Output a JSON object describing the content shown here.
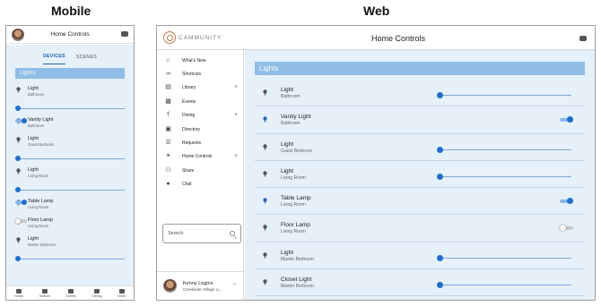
{
  "captions": {
    "mobile": "Mobile",
    "web": "Web"
  },
  "colors": {
    "accent": "#1f6fc8",
    "header_band": "#8fbde6",
    "content_bg": "#e6f0f9"
  },
  "mobile": {
    "header": {
      "title": "Home Controls",
      "chat_icon": "chat-bubble-icon"
    },
    "tabs": [
      {
        "label": "DEVICES",
        "active": true
      },
      {
        "label": "SCENES",
        "active": false
      }
    ],
    "section_title": "Lights",
    "lights": [
      {
        "name": "Light",
        "room": "Bathroom",
        "control": "slider",
        "level": 0
      },
      {
        "name": "Vanity Light",
        "room": "Bathroom",
        "control": "toggle",
        "on": true
      },
      {
        "name": "Light",
        "room": "Guest Bedroom",
        "control": "slider",
        "level": 0
      },
      {
        "name": "Light",
        "room": "Living Room",
        "control": "slider",
        "level": 0
      },
      {
        "name": "Table Lamp",
        "room": "Living Room",
        "control": "toggle",
        "on": true
      },
      {
        "name": "Floor Lamp",
        "room": "Living Room",
        "control": "toggle",
        "on": false
      },
      {
        "name": "Light",
        "room": "Master Bedroom",
        "control": "slider",
        "level": 0
      }
    ],
    "bottom_nav": [
      {
        "label": "Home",
        "icon": "home-icon"
      },
      {
        "label": "Search",
        "icon": "search-icon"
      },
      {
        "label": "Events",
        "icon": "calendar-icon"
      },
      {
        "label": "Dining",
        "icon": "dining-icon"
      },
      {
        "label": "More",
        "icon": "more-icon"
      }
    ]
  },
  "web": {
    "header": {
      "logo_text": "CAMMUNITY",
      "title": "Home Controls",
      "chat_icon": "chat-bubble-icon"
    },
    "sidebar": {
      "items": [
        {
          "label": "What's New",
          "icon": "home-icon",
          "expandable": false
        },
        {
          "label": "Shortcuts",
          "icon": "link-icon",
          "expandable": false
        },
        {
          "label": "Library",
          "icon": "book-icon",
          "expandable": true
        },
        {
          "label": "Events",
          "icon": "calendar-icon",
          "expandable": false
        },
        {
          "label": "Dining",
          "icon": "dining-icon",
          "expandable": true
        },
        {
          "label": "Directory",
          "icon": "contact-card-icon",
          "expandable": false
        },
        {
          "label": "Requests",
          "icon": "list-icon",
          "expandable": false
        },
        {
          "label": "Home Controls",
          "icon": "bulb-icon",
          "expandable": true
        },
        {
          "label": "Share",
          "icon": "people-icon",
          "expandable": false
        },
        {
          "label": "Chat",
          "icon": "chat-icon",
          "expandable": false
        }
      ],
      "search": {
        "placeholder": "Search"
      },
      "user": {
        "name": "Kenny Logins",
        "location": "Creekside Village a..."
      }
    },
    "section_title": "Lights",
    "lights": [
      {
        "name": "Light",
        "room": "Bathroom",
        "control": "slider",
        "level": 0
      },
      {
        "name": "Vanity Light",
        "room": "Bathroom",
        "control": "toggle",
        "on": true
      },
      {
        "name": "Light",
        "room": "Guest Bedroom",
        "control": "slider",
        "level": 0
      },
      {
        "name": "Light",
        "room": "Living Room",
        "control": "slider",
        "level": 0
      },
      {
        "name": "Table Lamp",
        "room": "Living Room",
        "control": "toggle",
        "on": true
      },
      {
        "name": "Floor Lamp",
        "room": "Living Room",
        "control": "toggle",
        "on": false
      },
      {
        "name": "Light",
        "room": "Master Bedroom",
        "control": "slider",
        "level": 0
      },
      {
        "name": "Closet Light",
        "room": "Master Bedroom",
        "control": "slider",
        "level": 0
      }
    ]
  }
}
